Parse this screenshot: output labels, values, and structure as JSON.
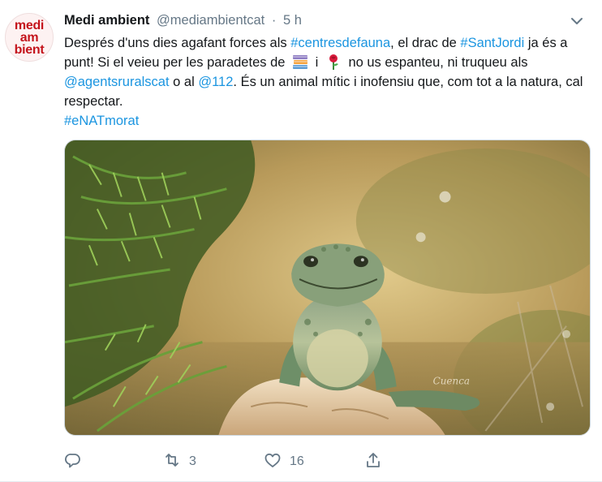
{
  "tweet": {
    "avatar_lines": [
      "medi",
      "am",
      "bient"
    ],
    "name": "Medi ambient",
    "handle": "@mediambientcat",
    "dot": "·",
    "time": "5 h",
    "text": {
      "p1": "Després d'uns dies agafant forces als ",
      "tag_centres": "#centresdefauna",
      "p2": ", el drac de ",
      "tag_santjordi": "#SantJordi",
      "p3": " ja és a punt! Si el veieu per les paradetes de ",
      "p4": " i ",
      "p5": " no us espanteu, ni truqueu als ",
      "mention_agents": "@agentsruralscat",
      "p6": " o al ",
      "mention_112": "@112",
      "p7": ". És un animal mític i inofensiu que, com tot a la natura, cal respectar.",
      "tag_enat": "#eNATmorat"
    },
    "emojis": [
      "books-emoji",
      "rose-emoji"
    ],
    "media": {
      "watermark": "Cuenca"
    },
    "actions": {
      "reply_count": "",
      "retweet_count": "3",
      "like_count": "16"
    },
    "colors": {
      "link": "#1b95e0",
      "muted": "#657786",
      "avatar_red": "#c4141c"
    }
  }
}
